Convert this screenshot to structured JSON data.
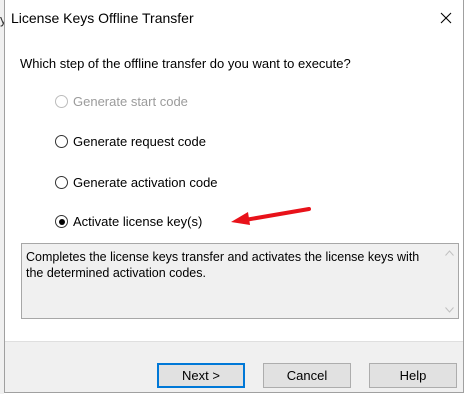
{
  "window": {
    "title": "License Keys Offline Transfer",
    "background_edge_glyph": "y"
  },
  "dialog": {
    "question": "Which step of the offline transfer do you want to execute?",
    "options": [
      {
        "label": "Generate start code",
        "selected": false,
        "enabled": false
      },
      {
        "label": "Generate request code",
        "selected": false,
        "enabled": true
      },
      {
        "label": "Generate activation code",
        "selected": false,
        "enabled": true
      },
      {
        "label": "Activate license key(s)",
        "selected": true,
        "enabled": true
      }
    ],
    "description": "Completes the license keys transfer and activates the license keys with the determined activation codes."
  },
  "buttons": {
    "next": "Next >",
    "cancel": "Cancel",
    "help": "Help"
  },
  "icons": {
    "close": "close-icon",
    "annotation": "red-arrow-icon",
    "scroll_up": "chevron-up-icon",
    "scroll_down": "chevron-down-icon"
  },
  "colors": {
    "annotation_arrow": "#e8121a",
    "default_button_border": "#0078d7",
    "dialog_background": "#f0f0f0"
  }
}
